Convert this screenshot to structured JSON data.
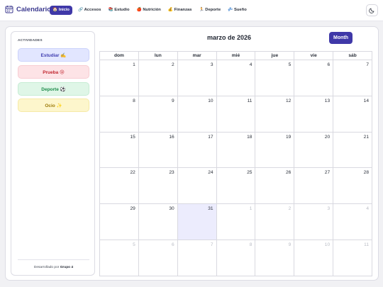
{
  "app": {
    "title": "Calendario",
    "icon": "calendar-icon"
  },
  "nav": {
    "items": [
      {
        "label": "🏠 Inicio",
        "active": true
      },
      {
        "label": "🔗 Accesos",
        "active": false
      },
      {
        "label": "📚 Estudio",
        "active": false
      },
      {
        "label": "🍎 Nutrición",
        "active": false
      },
      {
        "label": "💰 Finanzas",
        "active": false
      },
      {
        "label": "🏃 Deporte",
        "active": false
      },
      {
        "label": "💤 Sueño",
        "active": false
      }
    ]
  },
  "theme_toggle": {
    "icon": "moon-icon"
  },
  "sidebar": {
    "heading": "ACTIVIDADES",
    "activities": [
      {
        "label": "Estudiar ✍️",
        "color": "#e2e6ff"
      },
      {
        "label": "Prueba 😢",
        "color": "#fde3e6"
      },
      {
        "label": "Deporte ⚽",
        "color": "#dff6e7"
      },
      {
        "label": "Ocio ✨",
        "color": "#fdf6cc"
      }
    ],
    "footer_prefix": "Desarrollado por",
    "footer_name": "Grupo 4"
  },
  "calendar": {
    "title": "marzo de 2026",
    "view_button": "Month",
    "weekdays": [
      "dom",
      "lun",
      "mar",
      "mié",
      "jue",
      "vie",
      "sáb"
    ],
    "today": 31,
    "weeks": [
      [
        "1",
        "2",
        "3",
        "4",
        "5",
        "6",
        "7"
      ],
      [
        "8",
        "9",
        "10",
        "11",
        "12",
        "13",
        "14"
      ],
      [
        "15",
        "16",
        "17",
        "18",
        "19",
        "20",
        "21"
      ],
      [
        "22",
        "23",
        "24",
        "25",
        "26",
        "27",
        "28"
      ],
      [
        "29",
        "30",
        "31",
        "1",
        "2",
        "3",
        "4"
      ],
      [
        "5",
        "6",
        "7",
        "8",
        "9",
        "10",
        "11"
      ]
    ]
  },
  "colors": {
    "accent": "#3f38a8"
  }
}
